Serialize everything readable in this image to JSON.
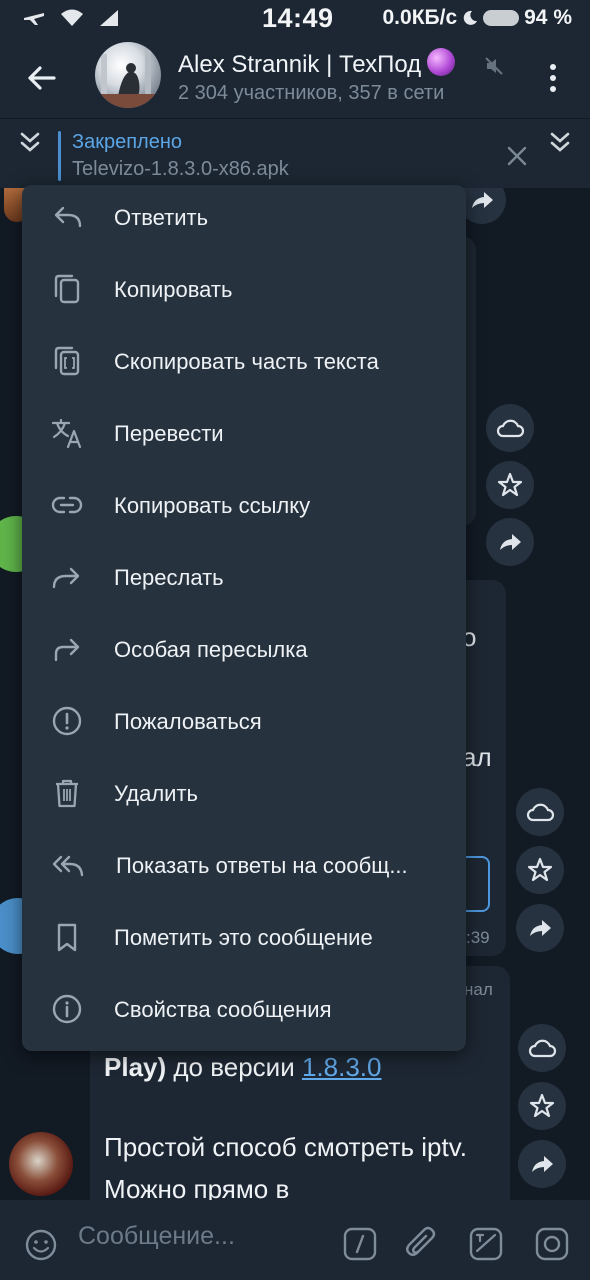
{
  "status_bar": {
    "time": "14:49",
    "network_speed": "0.0КБ/с",
    "battery": "94 %"
  },
  "header": {
    "title": "Alex Strannik | ТехПод",
    "subtitle": "2 304 участников, 357 в сети"
  },
  "pinned": {
    "label": "Закреплено",
    "text": "Televizo-1.8.3.0-x86.apk"
  },
  "context_menu": {
    "items": [
      {
        "label": "Ответить",
        "icon": "reply-icon"
      },
      {
        "label": "Копировать",
        "icon": "copy-icon"
      },
      {
        "label": "Скопировать часть текста",
        "icon": "copy-part-icon"
      },
      {
        "label": "Перевести",
        "icon": "translate-icon"
      },
      {
        "label": "Копировать ссылку",
        "icon": "link-icon"
      },
      {
        "label": "Переслать",
        "icon": "forward-icon"
      },
      {
        "label": "Особая пересылка",
        "icon": "special-forward-icon"
      },
      {
        "label": "Пожаловаться",
        "icon": "report-icon"
      },
      {
        "label": "Удалить",
        "icon": "delete-icon"
      },
      {
        "label": "Показать ответы на сообщ...",
        "icon": "reply-all-icon"
      },
      {
        "label": "Пометить это сообщение",
        "icon": "bookmark-icon"
      },
      {
        "label": "Свойства сообщения",
        "icon": "info-icon"
      }
    ]
  },
  "chat": {
    "peek_o": "о",
    "peek_al": "ал",
    "peek_time": ":39",
    "peek_nal": "нал",
    "line1_bold": "Play)",
    "line1_rest": " до версии ",
    "line1_link": "1.8.3.0",
    "line2": "Простой способ смотреть iptv.",
    "line3": "Можно прямо в"
  },
  "composer": {
    "placeholder": "Сообщение..."
  },
  "colors": {
    "accent": "#5ca6e6",
    "menu_bg": "#27323f",
    "chat_bg": "#121a24",
    "bar_bg": "#1c2733"
  }
}
